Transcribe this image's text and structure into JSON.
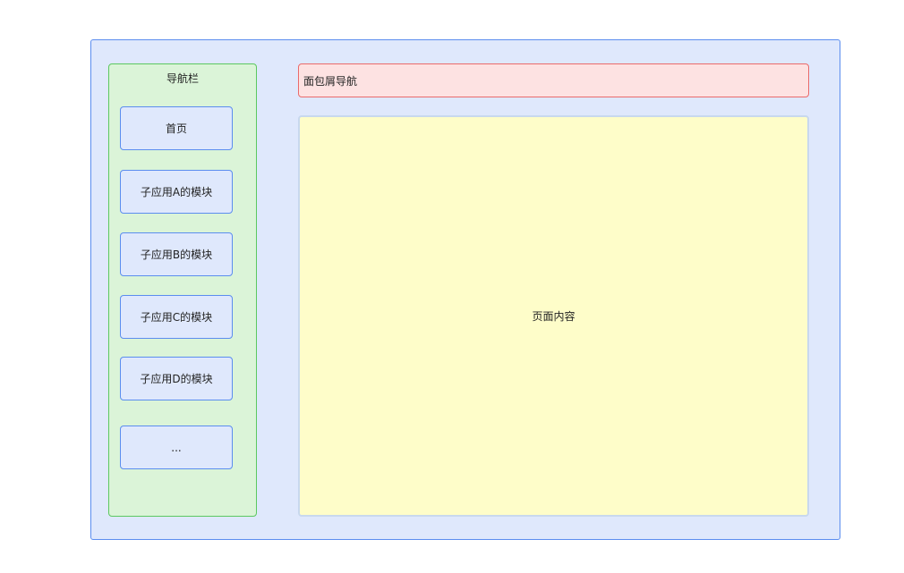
{
  "nav": {
    "title": "导航栏",
    "items": [
      {
        "label": "首页"
      },
      {
        "label": "子应用A的模块"
      },
      {
        "label": "子应用B的模块"
      },
      {
        "label": "子应用C的模块"
      },
      {
        "label": "子应用D的模块"
      },
      {
        "label": "..."
      }
    ]
  },
  "breadcrumb": {
    "label": "面包屑导航"
  },
  "content": {
    "label": "页面内容"
  },
  "colors": {
    "frame_fill": "#dfe8fc",
    "frame_border": "#5b8def",
    "nav_fill": "#dbf4d8",
    "nav_border": "#5cc860",
    "breadcrumb_fill": "#fde2e2",
    "breadcrumb_border": "#ea6b6b",
    "content_fill": "#fefdc9"
  }
}
